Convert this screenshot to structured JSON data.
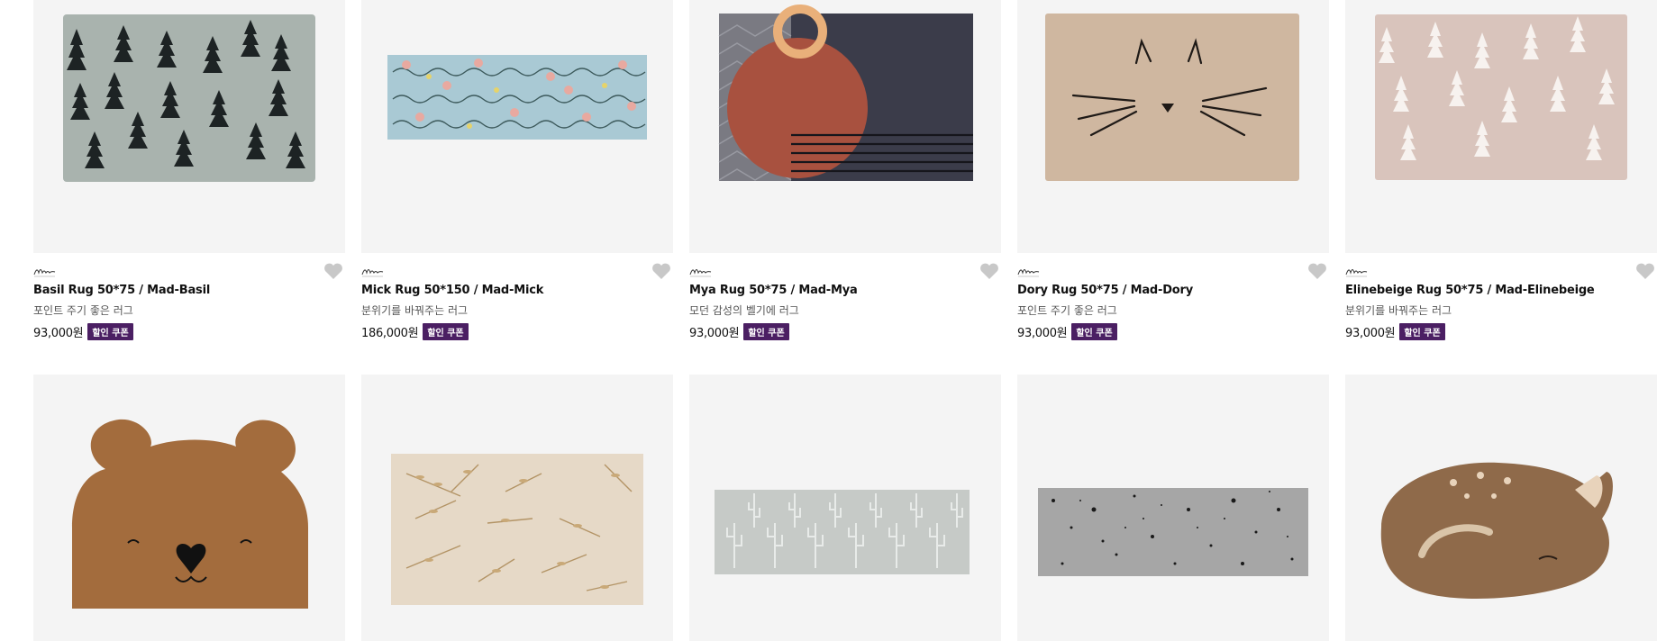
{
  "colors": {
    "badge_bg": "#4b1f63",
    "thumb_bg": "#f4f4f4",
    "heart": "#c8c8c8"
  },
  "products": [
    {
      "image_desc": "grey rug with black pine trees",
      "brand_icon": "mad-logo-icon",
      "title": "Basil Rug 50*75 / Mad-Basil",
      "desc": "포인트 주기 좋은 러그",
      "price": "93,000원",
      "badge": "할인 쿠폰"
    },
    {
      "image_desc": "light blue floral rug",
      "brand_icon": "mad-logo-icon",
      "title": "Mick Rug 50*150 / Mad-Mick",
      "desc": "분위기를 바꿔주는 러그",
      "price": "186,000원",
      "badge": "할인 쿠폰"
    },
    {
      "image_desc": "navy rug with terracotta circle and ring",
      "brand_icon": "mad-logo-icon",
      "title": "Mya Rug 50*75 / Mad-Mya",
      "desc": "모던 감성의 벨기에 러그",
      "price": "93,000원",
      "badge": "할인 쿠폰"
    },
    {
      "image_desc": "beige cat face rug",
      "brand_icon": "mad-logo-icon",
      "title": "Dory Rug 50*75 / Mad-Dory",
      "desc": "포인트 주기 좋은 러그",
      "price": "93,000원",
      "badge": "할인 쿠폰"
    },
    {
      "image_desc": "pink beige rug with white trees",
      "brand_icon": "mad-logo-icon",
      "title": "Elinebeige Rug 50*75 / Mad-Elinebeige",
      "desc": "분위기를 바꿔주는 러그",
      "price": "93,000원",
      "badge": "할인 쿠폰"
    },
    {
      "image_desc": "brown bear shaped rug"
    },
    {
      "image_desc": "cream rug with leaf branches"
    },
    {
      "image_desc": "light grey cactus pattern rug"
    },
    {
      "image_desc": "grey speckled rug"
    },
    {
      "image_desc": "sleeping fawn shaped rug"
    }
  ]
}
